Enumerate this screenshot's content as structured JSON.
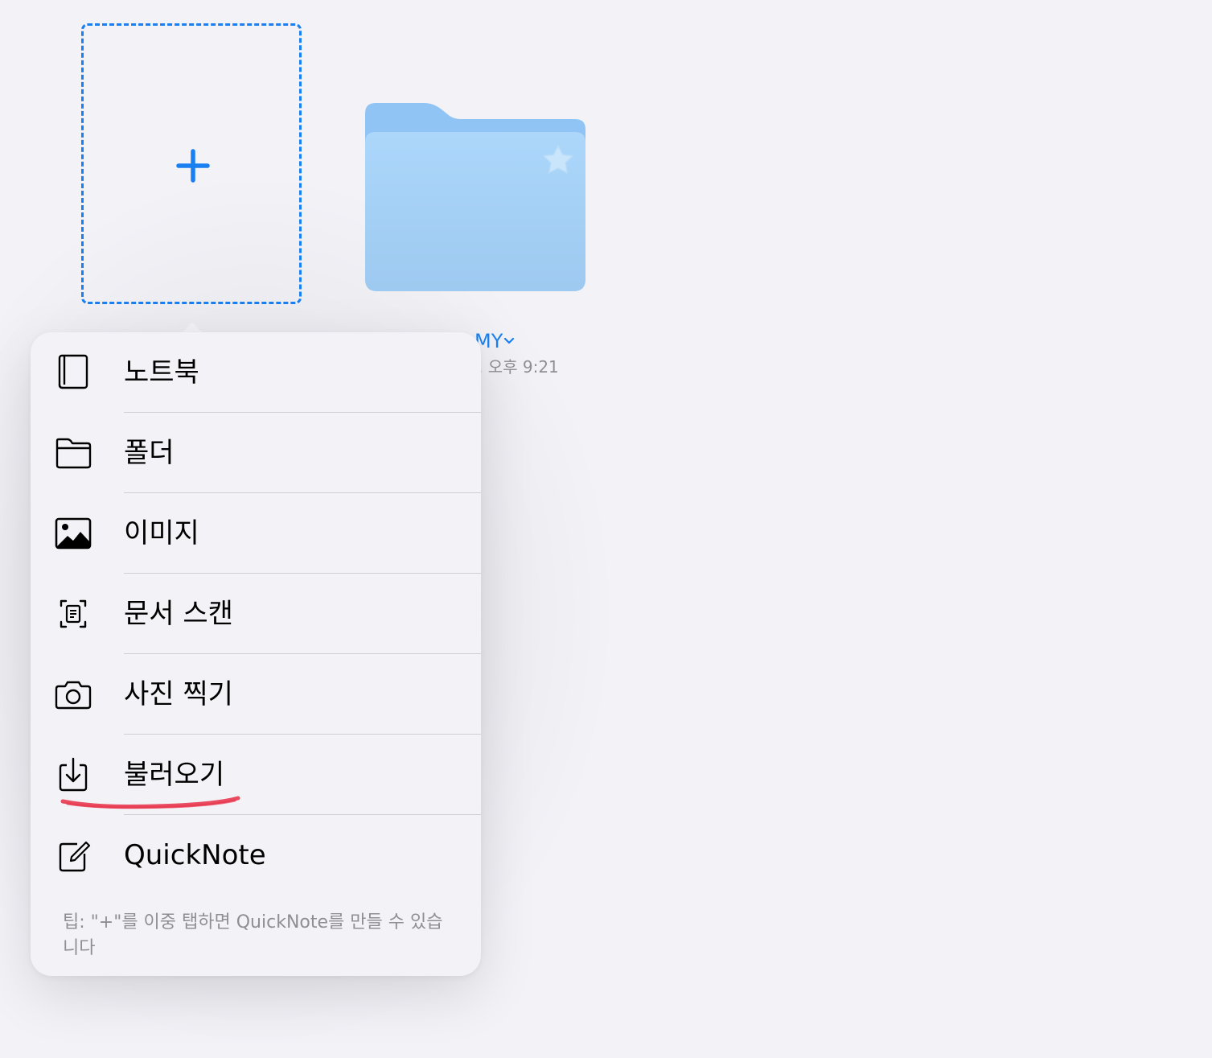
{
  "folder": {
    "title": "MY",
    "date": ". 오후 9:21"
  },
  "popover": {
    "items": [
      {
        "label": "노트북",
        "icon": "notebook-icon"
      },
      {
        "label": "폴더",
        "icon": "folder-icon"
      },
      {
        "label": "이미지",
        "icon": "image-icon"
      },
      {
        "label": "문서 스캔",
        "icon": "document-scan-icon"
      },
      {
        "label": "사진 찍기",
        "icon": "camera-icon"
      },
      {
        "label": "불러오기",
        "icon": "import-icon"
      },
      {
        "label": "QuickNote",
        "icon": "quicknote-icon"
      }
    ],
    "tip": "팁: \"+\"를 이중 탭하면 QuickNote를 만들 수 있습니다"
  },
  "colors": {
    "accent": "#1a7ff0",
    "background": "#f2f2f7",
    "popover": "#f3f3f7",
    "folder": "#a4d2fa",
    "annotation": "#e8384f"
  }
}
